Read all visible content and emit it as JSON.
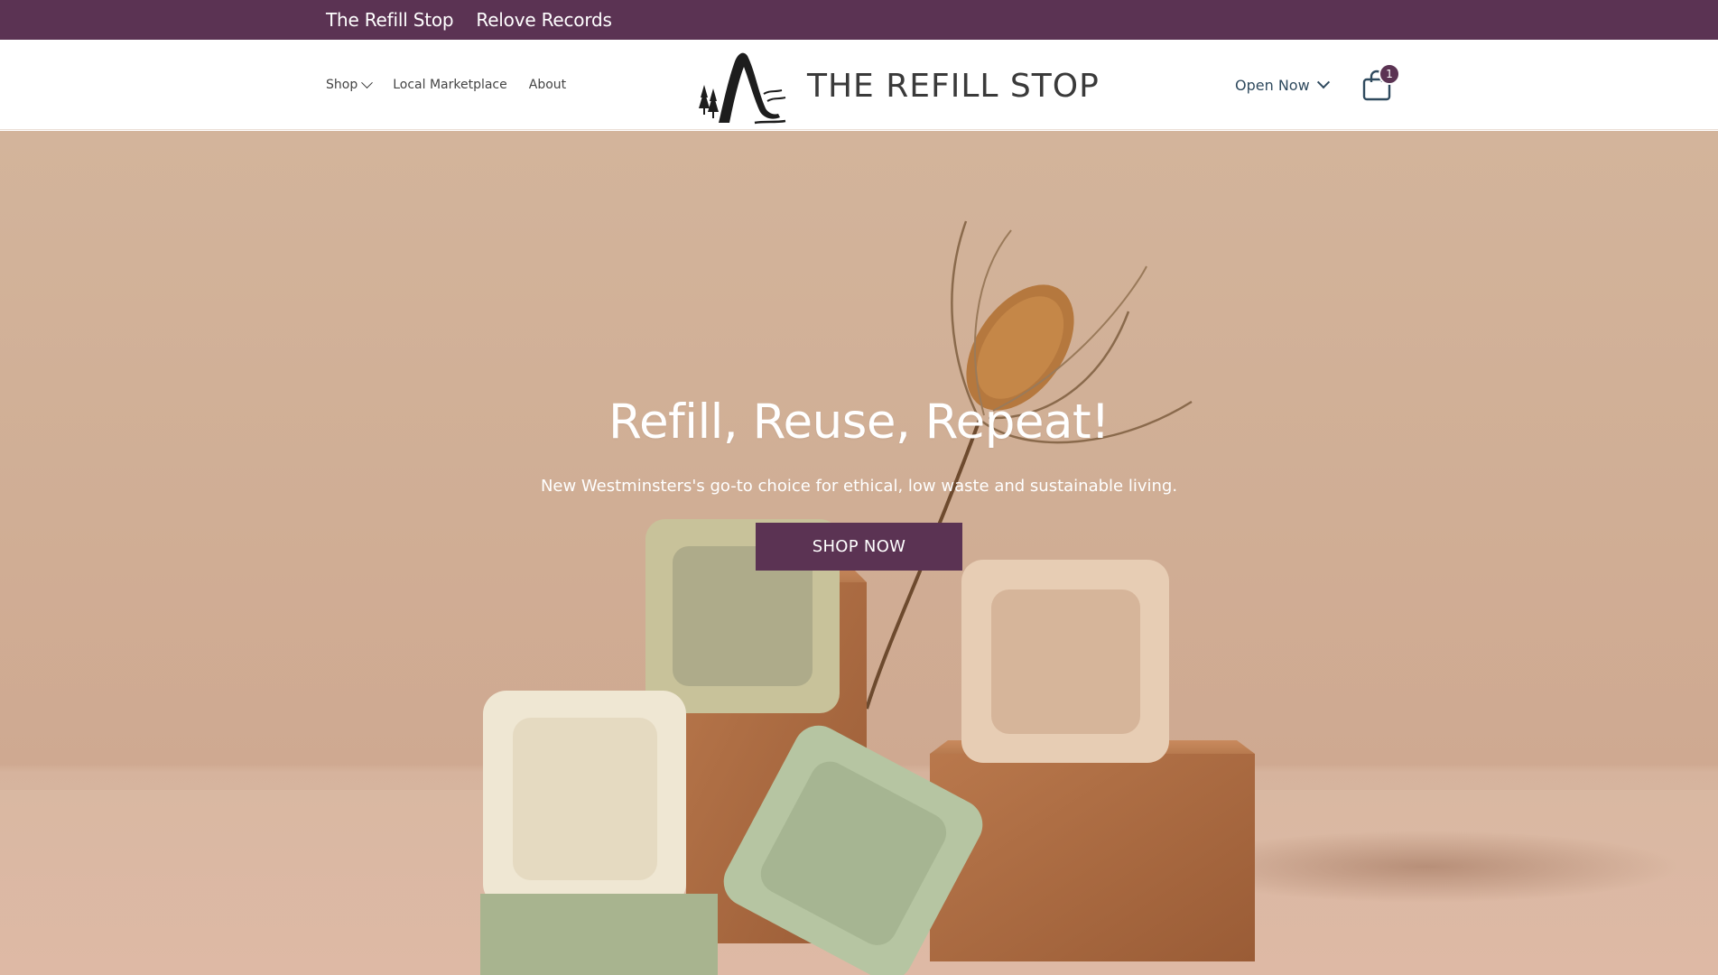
{
  "store_bar": {
    "links": [
      {
        "label": "The Refill Stop"
      },
      {
        "label": "Relove Records"
      }
    ]
  },
  "nav": {
    "items": [
      {
        "label": "Shop",
        "has_dropdown": true
      },
      {
        "label": "Local Marketplace"
      },
      {
        "label": "About"
      }
    ]
  },
  "brand": {
    "name": "THE REFILL STOP",
    "icon": "mountain-trees-logo"
  },
  "header_right": {
    "hours_label": "Open Now",
    "cart_icon": "shopping-bag-icon",
    "cart_count": "1"
  },
  "hero": {
    "title": "Refill, Reuse, Repeat!",
    "subtitle": "New Westminsters's go-to choice for ethical, low waste and sustainable living.",
    "cta_label": "SHOP NOW"
  },
  "colors": {
    "brand_purple": "#5b3353",
    "hero_bg": "#d0ae95",
    "text_dark": "#2f4a5e"
  }
}
